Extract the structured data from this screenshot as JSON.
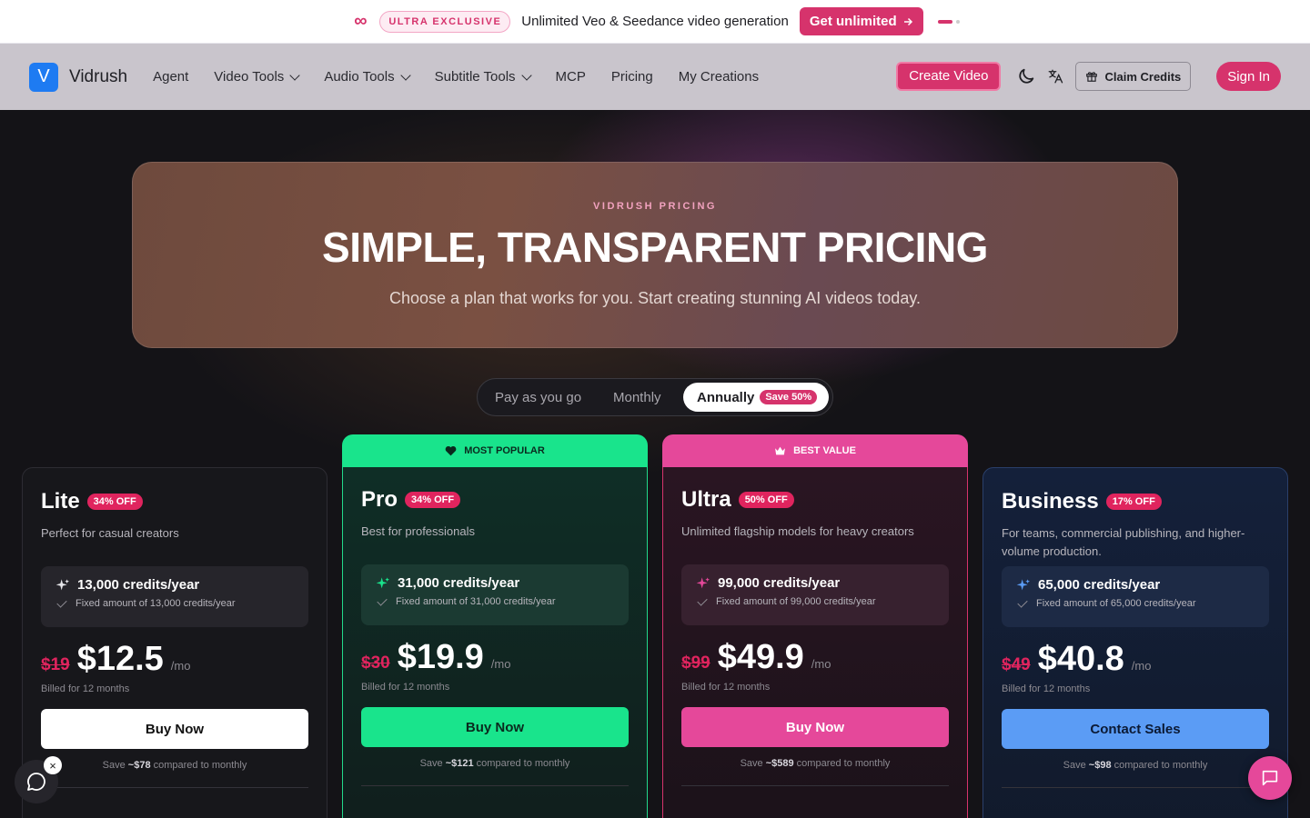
{
  "announcement": {
    "badge": "ULTRA EXCLUSIVE",
    "message": "Unlimited Veo & Seedance video generation",
    "cta": "Get unlimited",
    "accent": "#d6336c"
  },
  "nav": {
    "logo_letter": "V",
    "brand": "Vidrush",
    "items": [
      {
        "label": "Agent",
        "dropdown": false
      },
      {
        "label": "Video Tools",
        "dropdown": true
      },
      {
        "label": "Audio Tools",
        "dropdown": true
      },
      {
        "label": "Subtitle Tools",
        "dropdown": true
      },
      {
        "label": "MCP",
        "dropdown": false
      },
      {
        "label": "Pricing",
        "dropdown": false
      },
      {
        "label": "My Creations",
        "dropdown": false
      }
    ],
    "create_label": "Create Video",
    "claim_label": "Claim Credits",
    "signin_label": "Sign In"
  },
  "hero": {
    "eyebrow": "VIDRUSH PRICING",
    "title": "SIMPLE, TRANSPARENT PRICING",
    "subtitle": "Choose a plan that works for you. Start creating stunning AI videos today."
  },
  "billing_toggle": {
    "options": [
      "Pay as you go",
      "Monthly",
      "Annually"
    ],
    "selected": "Annually",
    "save_badge": "Save 50%"
  },
  "plans": [
    {
      "name": "Lite",
      "discount": "34% OFF",
      "description": "Perfect for casual creators",
      "credits": "13,000 credits/year",
      "credits_note": "Fixed amount of 13,000 credits/year",
      "old_price": "$19",
      "price": "$12.5",
      "per": "/mo",
      "billed": "Billed for 12 months",
      "button": "Buy Now",
      "savings_prefix": "Save ",
      "savings_amount": "~$78",
      "savings_suffix": " compared to monthly",
      "accent": "#ffffff"
    },
    {
      "name": "Pro",
      "discount": "34% OFF",
      "description": "Best for professionals",
      "ribbon": "MOST POPULAR",
      "credits": "31,000 credits/year",
      "credits_note": "Fixed amount of 31,000 credits/year",
      "old_price": "$30",
      "price": "$19.9",
      "per": "/mo",
      "billed": "Billed for 12 months",
      "button": "Buy Now",
      "savings_prefix": "Save ",
      "savings_amount": "~$121",
      "savings_suffix": " compared to monthly",
      "accent": "#19e48c"
    },
    {
      "name": "Ultra",
      "discount": "50% OFF",
      "description": "Unlimited flagship models for heavy creators",
      "ribbon": "BEST VALUE",
      "credits": "99,000 credits/year",
      "credits_note": "Fixed amount of 99,000 credits/year",
      "old_price": "$99",
      "price": "$49.9",
      "per": "/mo",
      "billed": "Billed for 12 months",
      "button": "Buy Now",
      "savings_prefix": "Save ",
      "savings_amount": "~$589",
      "savings_suffix": " compared to monthly",
      "accent": "#e5489a"
    },
    {
      "name": "Business",
      "discount": "17% OFF",
      "description": "For teams, commercial publishing, and higher-volume production.",
      "credits": "65,000 credits/year",
      "credits_note": "Fixed amount of 65,000 credits/year",
      "old_price": "$49",
      "price": "$40.8",
      "per": "/mo",
      "billed": "Billed for 12 months",
      "button": "Contact Sales",
      "savings_prefix": "Save ",
      "savings_amount": "~$98",
      "savings_suffix": " compared to monthly",
      "accent": "#5b9cf5"
    }
  ],
  "widgets": {
    "close_glyph": "×"
  }
}
